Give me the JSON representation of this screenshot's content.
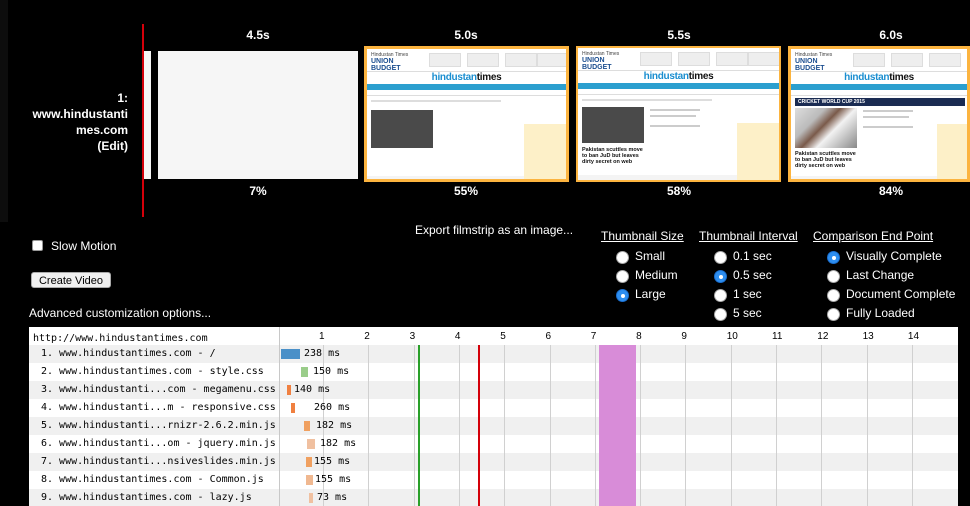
{
  "filmstrip": {
    "site_label_line1": "1:",
    "site_label_line2": "www.hindustanti",
    "site_label_line3": "mes.com",
    "edit_label": "(Edit)",
    "frames": [
      {
        "time": "4.5s",
        "percent": "7%"
      },
      {
        "time": "5.0s",
        "percent": "55%"
      },
      {
        "time": "5.5s",
        "percent": "58%"
      },
      {
        "time": "6.0s",
        "percent": "84%"
      }
    ],
    "thumb_text": {
      "budget_small": "Hindustan Times",
      "budget_big": "UNION BUDGET",
      "budget_year": "2015",
      "logo_pre": "hindustan",
      "logo_post": "times",
      "headline": "Pakistan scuttles move to ban JuD but leaves dirty secret on web",
      "cwc": "CRICKET WORLD CUP 2015"
    }
  },
  "controls": {
    "slow_motion_label": "Slow Motion",
    "export_label": "Export filmstrip as an image...",
    "create_video_label": "Create Video",
    "advanced_label": "Advanced customization options...",
    "thumbnail_size": {
      "title": "Thumbnail Size",
      "options": [
        "Small",
        "Medium",
        "Large"
      ],
      "selected": "Large"
    },
    "thumbnail_interval": {
      "title": "Thumbnail Interval",
      "options": [
        "0.1 sec",
        "0.5 sec",
        "1 sec",
        "5 sec"
      ],
      "selected": "0.5 sec"
    },
    "comparison_end_point": {
      "title": "Comparison End Point",
      "options": [
        "Visually Complete",
        "Last Change",
        "Document Complete",
        "Fully Loaded"
      ],
      "selected": "Visually Complete"
    }
  },
  "waterfall": {
    "url": "http://www.hindustantimes.com",
    "ticks": [
      "1",
      "2",
      "3",
      "4",
      "5",
      "6",
      "7",
      "8",
      "9",
      "10",
      "11",
      "12",
      "13",
      "14"
    ],
    "rows": [
      {
        "name": "1. www.hindustantimes.com - /",
        "time": "238 ms"
      },
      {
        "name": "2. www.hindustantimes.com - style.css",
        "time": "150 ms"
      },
      {
        "name": "3. www.hindustanti...com - megamenu.css",
        "time": "140 ms"
      },
      {
        "name": "4. www.hindustanti...m - responsive.css",
        "time": "260 ms"
      },
      {
        "name": "5. www.hindustanti...rnizr-2.6.2.min.js",
        "time": "182 ms"
      },
      {
        "name": "6. www.hindustanti...om - jquery.min.js",
        "time": "182 ms"
      },
      {
        "name": "7. www.hindustanti...nsiveslides.min.js",
        "time": "155 ms"
      },
      {
        "name": "8. www.hindustantimes.com - Common.js",
        "time": "155 ms"
      },
      {
        "name": "9. www.hindustantimes.com - lazy.js",
        "time": "73 ms"
      }
    ],
    "colors": {
      "start_render": "#2aa02a",
      "document_complete": "#d4000a",
      "visually_complete": "#d88cd8",
      "html_bar": "#4a90c8",
      "css_bar": "#9acd8a",
      "js_bar": "#f0a060"
    }
  }
}
